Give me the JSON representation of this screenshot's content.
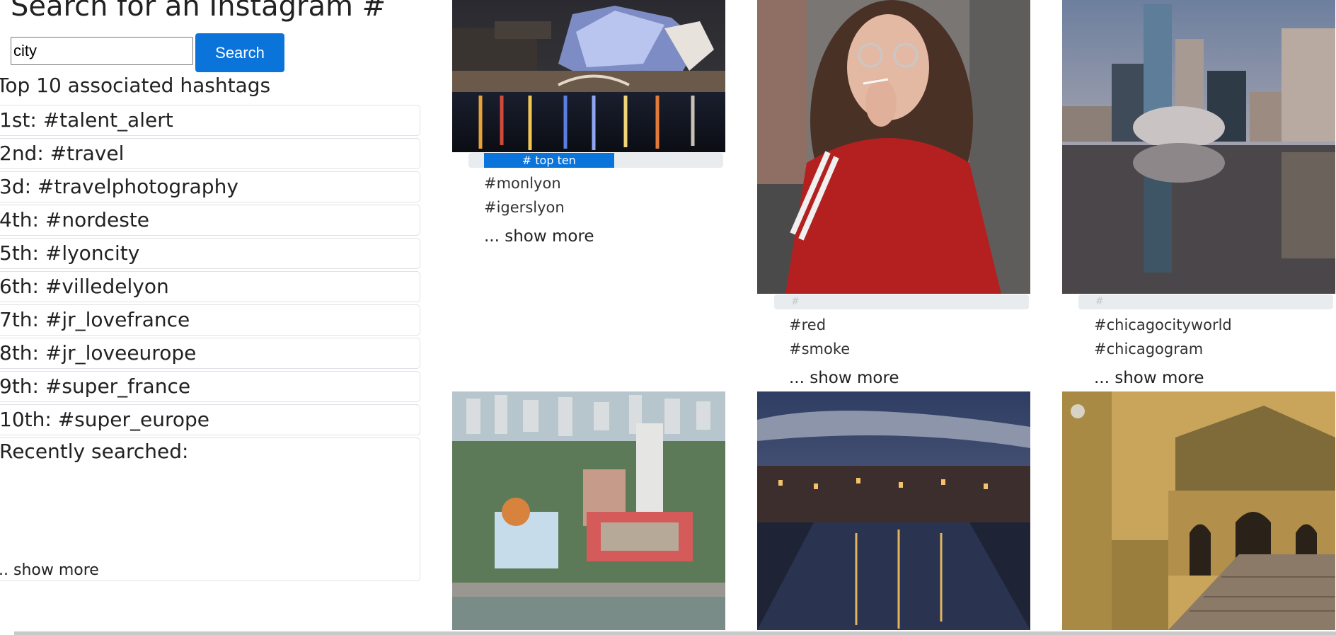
{
  "header": {
    "title": "Search for an Instagram #"
  },
  "search": {
    "value": "city",
    "button_label": "Search"
  },
  "top_hashtags": {
    "heading": "Top 10 associated hashtags",
    "items": [
      {
        "label": "1st: #talent_alert"
      },
      {
        "label": "2nd: #travel"
      },
      {
        "label": "3d: #travelphotography"
      },
      {
        "label": "4th: #nordeste"
      },
      {
        "label": "5th: #lyoncity"
      },
      {
        "label": "6th: #villedelyon"
      },
      {
        "label": "7th: #jr_lovefrance"
      },
      {
        "label": "8th: #jr_loveeurope"
      },
      {
        "label": "9th: #super_france"
      },
      {
        "label": "10th: #super_europe"
      }
    ]
  },
  "recent": {
    "heading": "Recently searched:",
    "more_label": ".. show more"
  },
  "posts": [
    {
      "image": "lyon-night-waterfront-photo",
      "bar_label": "# top ten",
      "bar_fraction": 0.51,
      "tags": [
        "#monlyon",
        "#igerslyon"
      ],
      "more_label": "... show more"
    },
    {
      "image": "woman-red-sweater-portrait-photo",
      "bar_label": "#",
      "bar_fraction": 0,
      "tags": [
        "#red",
        "#smoke"
      ],
      "more_label": "... show more"
    },
    {
      "image": "chicago-bean-skyline-photo",
      "bar_label": "#",
      "bar_fraction": 0,
      "tags": [
        "#chicagocityworld",
        "#chicagogram"
      ],
      "more_label": "... show more"
    },
    {
      "image": "recife-aerial-city-photo"
    },
    {
      "image": "amsterdam-canal-dusk-photo"
    },
    {
      "image": "amalfi-cathedral-stairs-photo"
    }
  ],
  "colors": {
    "accent": "#0a74da",
    "bar_track": "#e9ecef",
    "border": "#dee2e6"
  }
}
